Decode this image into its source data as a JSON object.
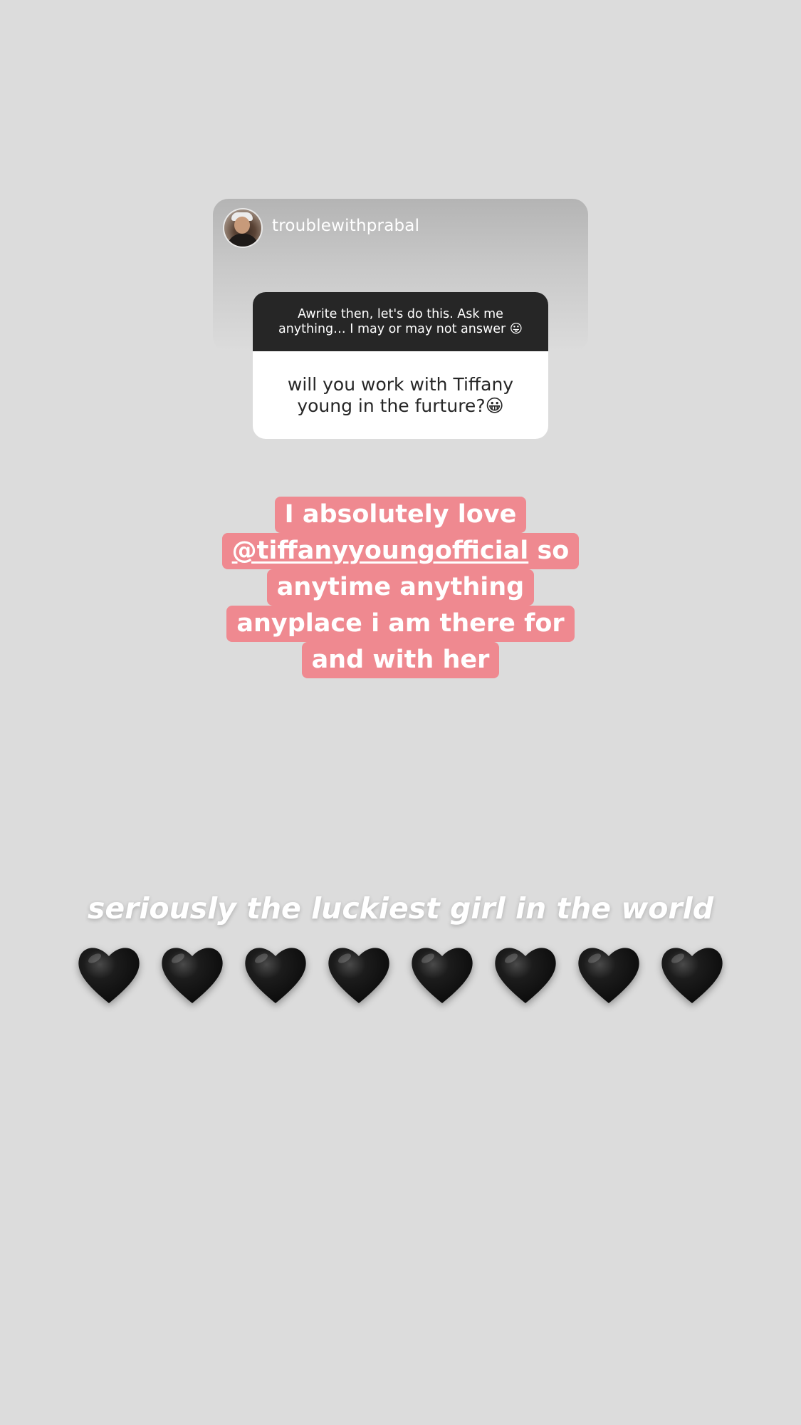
{
  "story": {
    "username": "troublewithprabal",
    "question_prompt": "Awrite then, let's do this. Ask me anything… I may or may not answer 😛",
    "question_answer": "will you work with Tiffany young in the furture?😀",
    "reply_lines": [
      "I absolutely love",
      "so",
      "anytime anything",
      "anyplace i am there for",
      "and with her"
    ],
    "reply_mention": "@tiffanyyoungofficial",
    "caption": "seriously the luckiest girl in the world",
    "hearts_count": 8,
    "heart_icon": "black-heart-icon"
  },
  "colors": {
    "background": "#dcdcdc",
    "highlight": "#ef8990",
    "sticker_header": "#262626"
  }
}
